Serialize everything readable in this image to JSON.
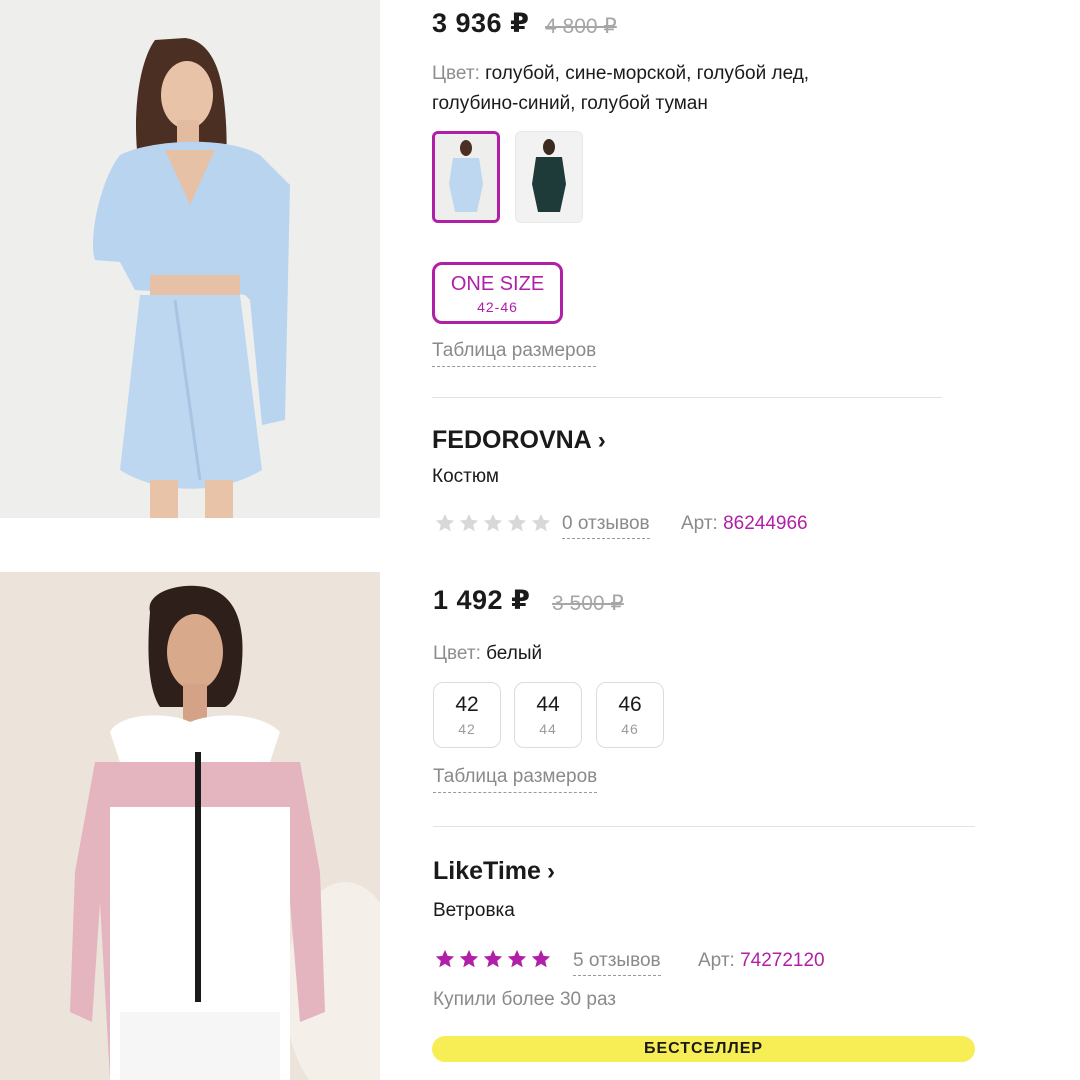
{
  "product1": {
    "price": "3 936 ₽",
    "old_price": "4 800 ₽",
    "color_label": "Цвет:",
    "color_value_line1": "голубой, сине-морской, голубой лед,",
    "color_value_line2": "голубино-синий, голубой туман",
    "swatches": [
      {
        "name": "light-blue-suit",
        "selected": true
      },
      {
        "name": "dark-green-suit",
        "selected": false
      }
    ],
    "size": {
      "label": "ONE SIZE",
      "range": "42-46"
    },
    "size_table_link": "Таблица размеров",
    "brand": "FEDOROVNA",
    "type": "Костюм",
    "rating": 0,
    "reviews": "0 отзывов",
    "art_label": "Арт:",
    "art_number": "86244966",
    "colors": {
      "main": "#bcd7ef",
      "alt": "#1f3b39"
    }
  },
  "product2": {
    "price": "1 492 ₽",
    "old_price": "3 500 ₽",
    "color_label": "Цвет:",
    "color_value": "белый",
    "sizes": [
      {
        "label": "42",
        "sub": "42"
      },
      {
        "label": "44",
        "sub": "44"
      },
      {
        "label": "46",
        "sub": "46"
      }
    ],
    "size_table_link": "Таблица размеров",
    "brand": "LikeTime",
    "type": "Ветровка",
    "rating": 5,
    "reviews": "5 отзывов",
    "art_label": "Арт:",
    "art_number": "74272120",
    "bought": "Купили более 30 раз",
    "badge": "БЕСТСЕЛЛЕР"
  },
  "theme": {
    "accent": "#b21fa7",
    "badge_color": "#f7ee55",
    "muted_text": "#8a8a8a",
    "star_empty": "#d8d8d8"
  },
  "icons": {
    "chevron": "chevron-right-icon",
    "star": "star-icon"
  }
}
